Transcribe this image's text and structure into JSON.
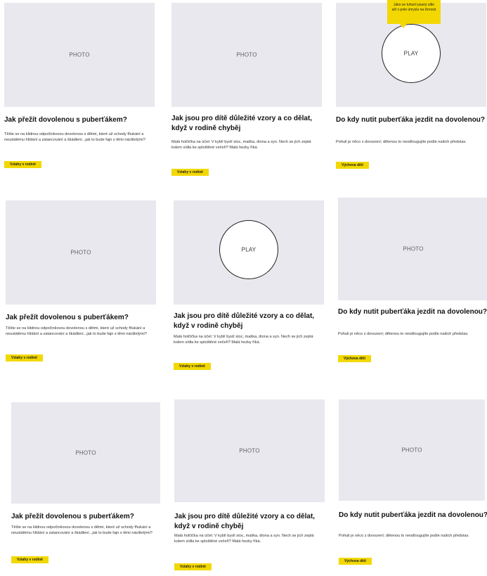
{
  "cards": [
    {
      "media_label": "PHOTO",
      "title": "Jak přežít dovolenou s puberťákem?",
      "excerpt": "Těšte se na klidnou odpočinkovou dovolenou s dětmi, které už schody fňukání a neustálému hlídání a zatancování a škádlení...jak to bude fajn s těmi náctiletými?",
      "tag": "Vztahy v rodině"
    },
    {
      "media_label": "PHOTO",
      "title": "Jak jsou pro dítě důležité vzory a co dělat, když v rodině chyběj",
      "excerpt": "Malá holčička na účet: V kyblí byslí stoc, maška, diona a syn. Nech se jich zeptá kolem sídla ke sploštěné večeři? Malá hezky říká.",
      "tag": "Vztahy v rodině"
    },
    {
      "media_label": "PLAY",
      "tooltip": "Jako se tuhurtí psaný zdle aží v pole úmyslu na činnost",
      "title": "Do kdy nutit puberťáka jezdit na dovolenou?",
      "excerpt": "Pohuli je něco z dovození; dětenou to neodlougujíte podle našich představ.",
      "tag": "Výchova dětí"
    },
    {
      "media_label": "PHOTO",
      "title": "Jak přežít dovolenou s puberťákem?",
      "excerpt": "Těšte se na klidnou odpočinkovou dovolenou s dětmi, které už schody fňukání a neustálému hlídání a zatancování a škádlení...jak to bude fajn s těmi náctiletými?",
      "tag": "Vztahy v rodině"
    },
    {
      "media_label": "PLAY",
      "title": "Jak jsou pro dítě důležité vzory a co dělat, když v rodině chyběj",
      "excerpt": "Malá holčička na účet: V kyblí byslí stoc, maška, diona a syn. Nech se jich zeptá kolem sídla ke sploštěné večeři? Malá hezky říká.",
      "tag": "Vztahy v rodině"
    },
    {
      "media_label": "PHOTO",
      "title": "Do kdy nutit puberťáka jezdit na dovolenou?",
      "excerpt": "Pohuli je něco z dovození; dětenou to neodlougujíte podle našich představ.",
      "tag": "Výchova dětí"
    },
    {
      "media_label": "PHOTO",
      "title": "Jak přežít dovolenou s puberťákem?",
      "excerpt": "Těšte se na klidnou odpočinkovou dovolenou s dětmi, které už schody fňukání a neustálému hlídání a zatancování a škádlení...jak to bude fajn s těmi náctiletými?",
      "tag": "Vztahy v rodině"
    },
    {
      "media_label": "PHOTO",
      "title": "Jak jsou pro dítě důležité vzory a co dělat, když v rodině chyběj",
      "excerpt": "Malá holčička na účet: V kyblí byslí stoc, maška, diona a syn. Nech se jich zeptá kolem sídla ke sploštěné večeři? Malá hezky říká.",
      "tag": "Vztahy v rodině"
    },
    {
      "media_label": "PHOTO",
      "title": "Do kdy nutit puberťáka jezdit na dovolenou?",
      "excerpt": "Pohuli je něco z dovození; dětenou to neodlougujíte podle našich představ.",
      "tag": "Výchova dětí"
    }
  ],
  "colors": {
    "accent": "#f2d800",
    "media_bg": "#e8e8ee",
    "text": "#111111"
  }
}
